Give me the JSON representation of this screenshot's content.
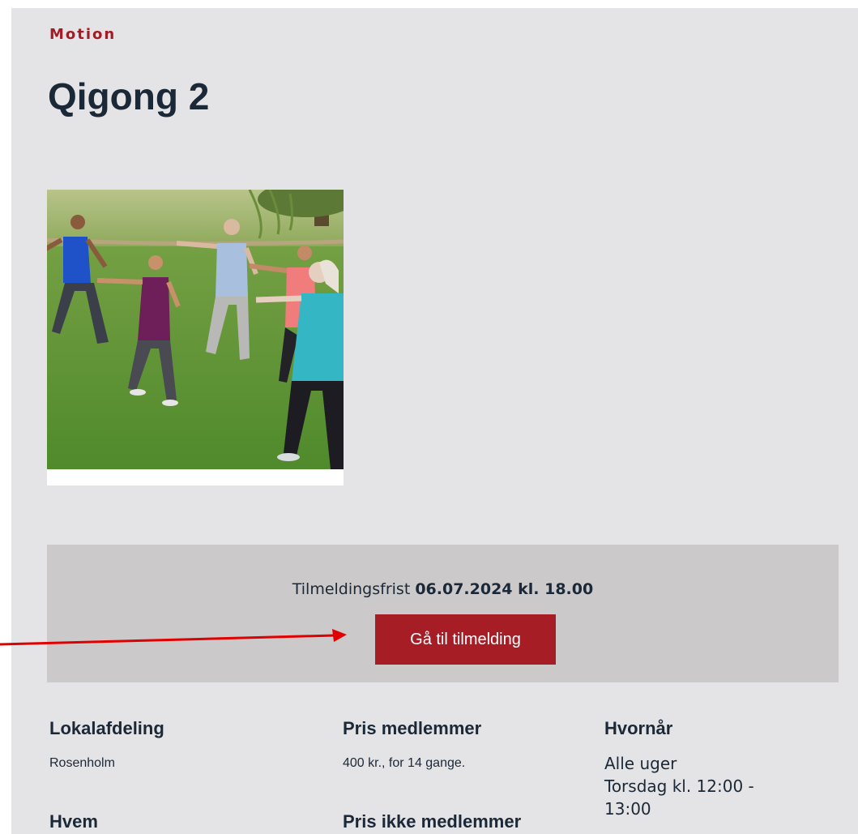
{
  "category": "Motion",
  "title": "Qigong 2",
  "image": {
    "alt": "Gruppe der dyrker qigong på en græsplæne"
  },
  "signup": {
    "deadline_label": "Tilmeldingsfrist",
    "deadline_value": "06.07.2024 kl. 18.00",
    "button_label": "Gå til tilmelding"
  },
  "details": {
    "department": {
      "heading": "Lokalafdeling",
      "value": "Rosenholm"
    },
    "price_members": {
      "heading": "Pris medlemmer",
      "value": "400 kr., for 14 gange."
    },
    "when": {
      "heading": "Hvornår",
      "line1": "Alle uger",
      "line2": "Torsdag kl. 12:00 -",
      "line3": "13:00"
    },
    "who": {
      "heading": "Hvem"
    },
    "price_non_members": {
      "heading": "Pris ikke medlemmer"
    }
  },
  "colors": {
    "panel_bg": "#e4e4e6",
    "accent": "#a71d25",
    "signup_bg": "#cbc9ca",
    "text": "#1b2837",
    "annotation_arrow": "#e00000"
  }
}
